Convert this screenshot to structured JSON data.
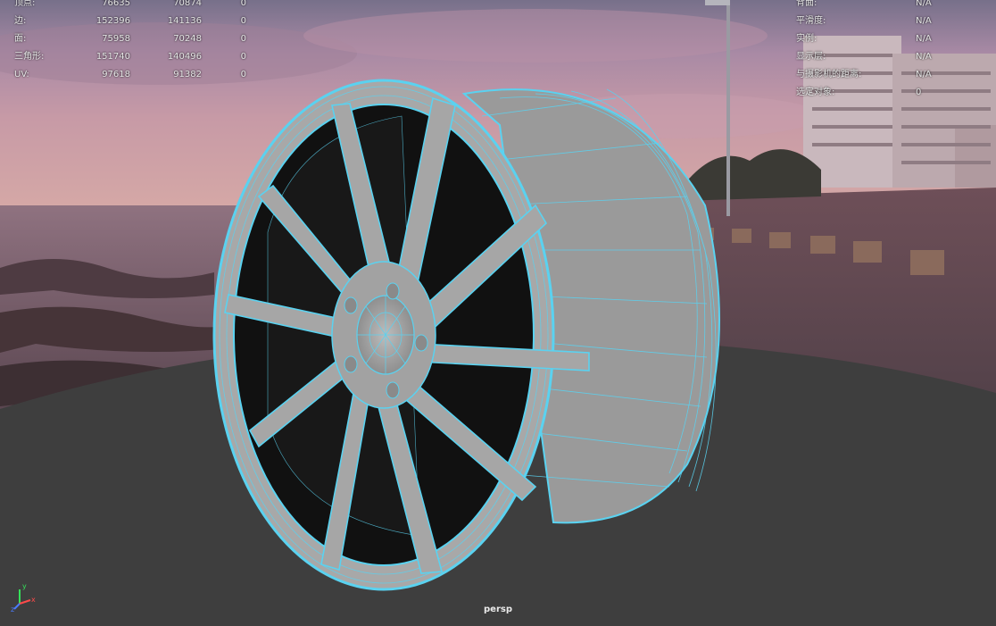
{
  "stats": {
    "rows": [
      {
        "label": "顶点:",
        "v1": "76635",
        "v2": "70874",
        "v3": "0"
      },
      {
        "label": "边:",
        "v1": "152396",
        "v2": "141136",
        "v3": "0"
      },
      {
        "label": "面:",
        "v1": "75958",
        "v2": "70248",
        "v3": "0"
      },
      {
        "label": "三角形:",
        "v1": "151740",
        "v2": "140496",
        "v3": "0"
      },
      {
        "label": "UV:",
        "v1": "97618",
        "v2": "91382",
        "v3": "0"
      }
    ]
  },
  "info": {
    "rows": [
      {
        "label": "背面:",
        "value": "N/A"
      },
      {
        "label": "平滑度:",
        "value": "N/A"
      },
      {
        "label": "实例:",
        "value": "N/A"
      },
      {
        "label": "显示层:",
        "value": "N/A"
      },
      {
        "label": "与摄影机的距离:",
        "value": "N/A"
      },
      {
        "label": "选定对象:",
        "value": "0"
      }
    ]
  },
  "camera": {
    "name": "persp"
  },
  "colors": {
    "wireframe": "#5ad2f0",
    "ground": "#3e3e3e",
    "sky": "#b78a9d"
  },
  "gizmo": {
    "x_label": "x",
    "y_label": "y",
    "z_label": "z"
  }
}
